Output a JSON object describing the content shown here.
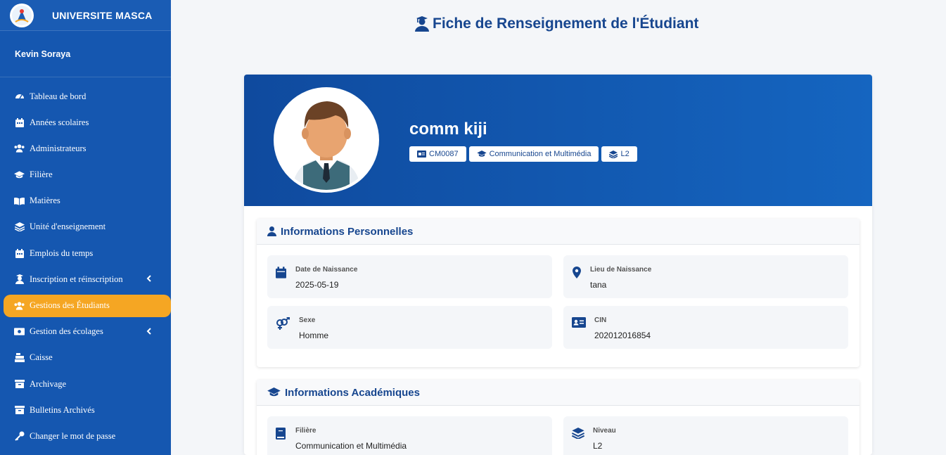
{
  "brand": {
    "name": "UNIVERSITE MASCA"
  },
  "user": {
    "name": "Kevin Soraya"
  },
  "nav": [
    {
      "label": "Tableau de bord",
      "icon": "dashboard-icon"
    },
    {
      "label": "Années scolaires",
      "icon": "calendar-icon"
    },
    {
      "label": "Administrateurs",
      "icon": "users-icon"
    },
    {
      "label": "Filière",
      "icon": "graduation-cap-icon"
    },
    {
      "label": "Matières",
      "icon": "book-open-icon"
    },
    {
      "label": "Unité d'enseignement",
      "icon": "layers-icon"
    },
    {
      "label": "Emplois du temps",
      "icon": "calendar-icon"
    },
    {
      "label": "Inscription et réinscription",
      "icon": "user-graduate-icon",
      "caret": true
    },
    {
      "label": "Gestions des Étudiants",
      "icon": "users-icon",
      "active": true
    },
    {
      "label": "Gestion des écolages",
      "icon": "money-icon",
      "caret": true
    },
    {
      "label": "Caisse",
      "icon": "cash-register-icon"
    },
    {
      "label": "Archivage",
      "icon": "archive-icon"
    },
    {
      "label": "Bulletins Archivés",
      "icon": "archive-icon"
    },
    {
      "label": "Changer le mot de passe",
      "icon": "key-icon"
    }
  ],
  "page": {
    "title": "Fiche de Renseignement de l'Étudiant"
  },
  "student": {
    "name": "comm kiji",
    "matricule": "CM0087",
    "filiere": "Communication et Multimédia",
    "niveau": "L2"
  },
  "personal": {
    "title": "Informations Personnelles",
    "birth_date_label": "Date de Naissance",
    "birth_date": "2025-05-19",
    "birth_place_label": "Lieu de Naissance",
    "birth_place": "tana",
    "sex_label": "Sexe",
    "sex": "Homme",
    "cin_label": "CIN",
    "cin": "202012016854"
  },
  "academic": {
    "title": "Informations Académiques",
    "filiere_label": "Filière",
    "filiere": "Communication et Multimédia",
    "niveau_label": "Niveau",
    "niveau": "L2"
  },
  "colors": {
    "sidebar": "#1557b0",
    "accent": "#f5a623",
    "primary_text": "#17468f"
  }
}
